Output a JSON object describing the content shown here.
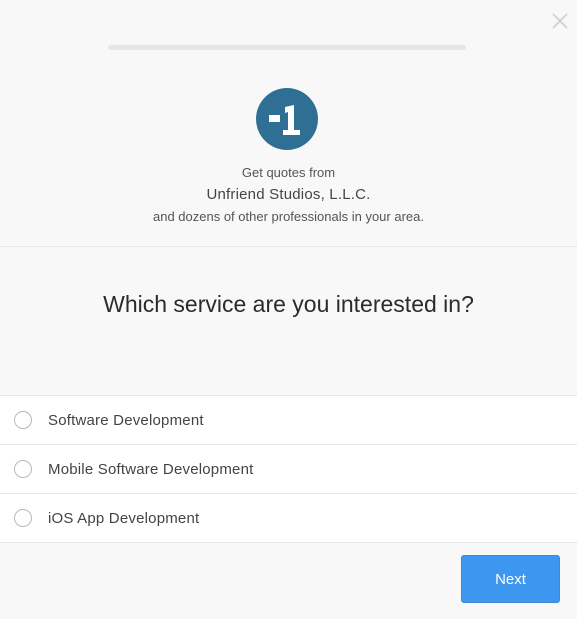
{
  "modal": {
    "close_icon": "close-icon",
    "progress_percent": 0
  },
  "intro": {
    "logo_text": "-1",
    "logo_color": "#2f6f94",
    "line1": "Get quotes from",
    "business_name": "Unfriend Studios, L.L.C.",
    "line3": "and dozens of other professionals in your area."
  },
  "question": {
    "title": "Which service are you interested in?"
  },
  "options": [
    {
      "label": "Software Development",
      "selected": false
    },
    {
      "label": "Mobile Software Development",
      "selected": false
    },
    {
      "label": "iOS App Development",
      "selected": false
    }
  ],
  "footer": {
    "next_label": "Next",
    "accent_color": "#3d97f0"
  }
}
